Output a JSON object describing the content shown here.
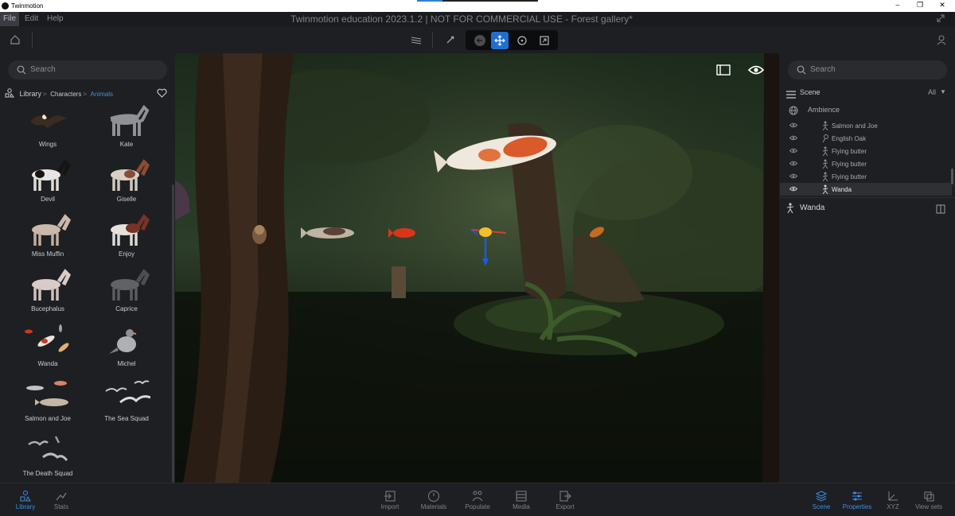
{
  "os_bar": {
    "app_title": "Twinmotion",
    "controls": [
      "–",
      "❐",
      "✕"
    ]
  },
  "menu": {
    "items": [
      "File",
      "Edit",
      "Help"
    ],
    "window_title": "Twinmotion education 2023.1.2 | NOT FOR COMMERCIAL USE - Forest gallery*"
  },
  "toolbar": {
    "icons": [
      "home-icon",
      "layers-icon",
      "eyedropper-icon",
      "undo-icon",
      "move-icon",
      "rotate-icon",
      "scale-icon",
      "user-icon",
      "fullscreen-icon"
    ]
  },
  "library": {
    "search_placeholder": "Search",
    "breadcrumb": [
      "Library",
      "Characters",
      "Animals"
    ],
    "items": [
      {
        "label": "Wings"
      },
      {
        "label": "Kate"
      },
      {
        "label": "Devil"
      },
      {
        "label": "Giselle"
      },
      {
        "label": "Miss Muffin"
      },
      {
        "label": "Enjoy"
      },
      {
        "label": "Bucephalus"
      },
      {
        "label": "Caprice"
      },
      {
        "label": "Wanda"
      },
      {
        "label": "Michel"
      },
      {
        "label": "Salmon and Joe"
      },
      {
        "label": "The Sea Squad"
      },
      {
        "label": "The Death Squad"
      }
    ]
  },
  "scene": {
    "search_placeholder": "Search",
    "title": "Scene",
    "filter": "All",
    "group": "Ambience",
    "rows": [
      {
        "name": "Salmon and Joe",
        "icon": "character-icon"
      },
      {
        "name": "English Oak",
        "icon": "tree-icon"
      },
      {
        "name": "Flying butter",
        "icon": "character-icon"
      },
      {
        "name": "Flying butter",
        "icon": "character-icon"
      },
      {
        "name": "Flying butter",
        "icon": "character-icon"
      },
      {
        "name": "Wanda",
        "icon": "character-icon",
        "selected": true
      }
    ],
    "properties_title": "Wanda"
  },
  "bottom": {
    "left": [
      {
        "label": "Library",
        "active": true
      },
      {
        "label": "Stats"
      }
    ],
    "center": [
      {
        "label": "Import"
      },
      {
        "label": "Materials"
      },
      {
        "label": "Populate"
      },
      {
        "label": "Media"
      },
      {
        "label": "Export"
      }
    ],
    "right": [
      {
        "label": "Scene",
        "active": true
      },
      {
        "label": "Properties",
        "active": true
      },
      {
        "label": "XYZ"
      },
      {
        "label": "View sets"
      }
    ]
  },
  "colors": {
    "accent": "#3d8fe6",
    "active_button": "#1f6fd0",
    "panel_bg": "#1e1f22"
  }
}
